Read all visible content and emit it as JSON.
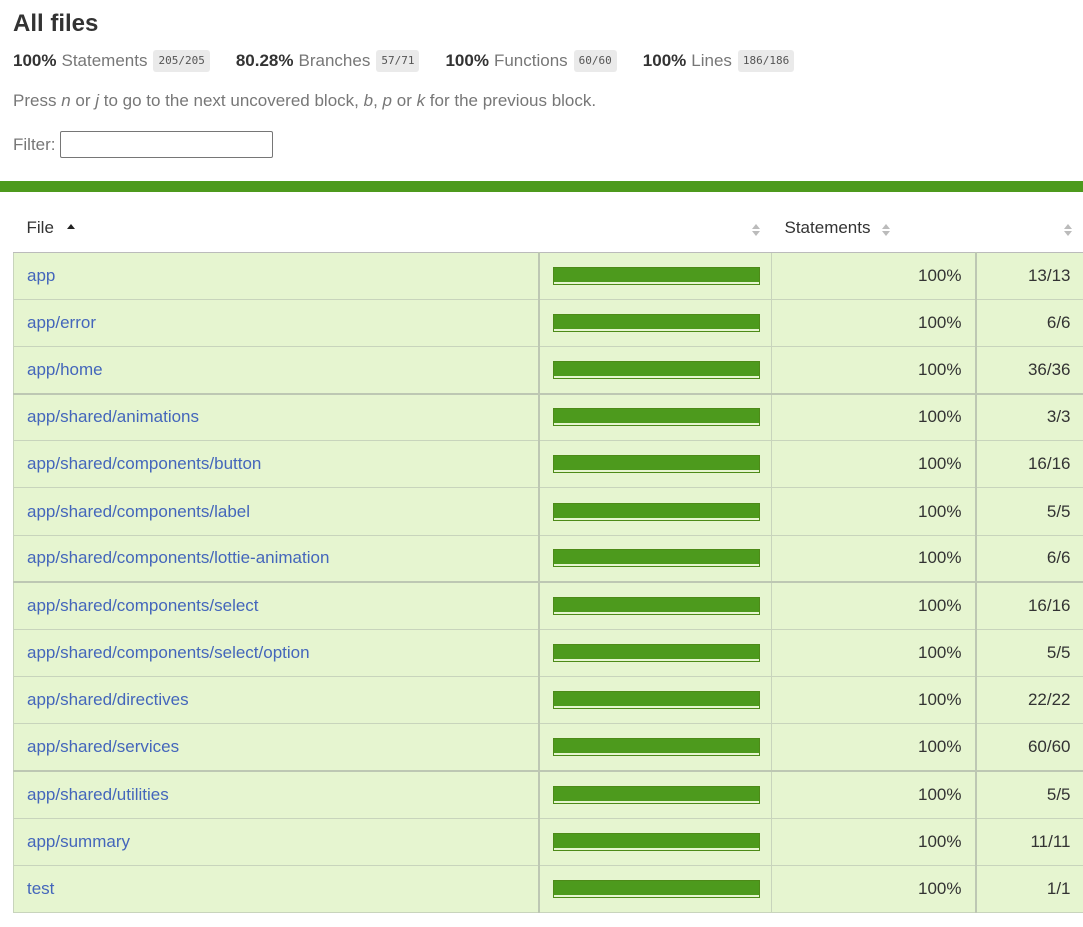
{
  "title": "All files",
  "summary": [
    {
      "pct": "100%",
      "name": "Statements",
      "frac": "205/205"
    },
    {
      "pct": "80.28%",
      "name": "Branches",
      "frac": "57/71"
    },
    {
      "pct": "100%",
      "name": "Functions",
      "frac": "60/60"
    },
    {
      "pct": "100%",
      "name": "Lines",
      "frac": "186/186"
    }
  ],
  "hint": {
    "p1": "Press ",
    "k1": "n",
    "p2": " or ",
    "k2": "j",
    "p3": " to go to the next uncovered block, ",
    "k3": "b",
    "p4": ", ",
    "k4": "p",
    "p5": " or ",
    "k5": "k",
    "p6": " for the previous block."
  },
  "filter": {
    "label": "Filter:",
    "value": "",
    "placeholder": ""
  },
  "colors": {
    "status_bar": "#4d9a1d",
    "row_bg": "#e6f5d0",
    "link": "#4466bb"
  },
  "table": {
    "headers": {
      "file": "File",
      "statements": "Statements"
    },
    "sort": "file-ascending",
    "rows": [
      {
        "file": "app",
        "coverage": 1.0,
        "pct": "100%",
        "abs": "13/13"
      },
      {
        "file": "app/error",
        "coverage": 1.0,
        "pct": "100%",
        "abs": "6/6"
      },
      {
        "file": "app/home",
        "coverage": 1.0,
        "pct": "100%",
        "abs": "36/36"
      },
      {
        "file": "app/shared/animations",
        "coverage": 1.0,
        "pct": "100%",
        "abs": "3/3"
      },
      {
        "file": "app/shared/components/button",
        "coverage": 1.0,
        "pct": "100%",
        "abs": "16/16"
      },
      {
        "file": "app/shared/components/label",
        "coverage": 1.0,
        "pct": "100%",
        "abs": "5/5"
      },
      {
        "file": "app/shared/components/lottie-animation",
        "coverage": 1.0,
        "pct": "100%",
        "abs": "6/6"
      },
      {
        "file": "app/shared/components/select",
        "coverage": 1.0,
        "pct": "100%",
        "abs": "16/16"
      },
      {
        "file": "app/shared/components/select/option",
        "coverage": 1.0,
        "pct": "100%",
        "abs": "5/5"
      },
      {
        "file": "app/shared/directives",
        "coverage": 1.0,
        "pct": "100%",
        "abs": "22/22"
      },
      {
        "file": "app/shared/services",
        "coverage": 1.0,
        "pct": "100%",
        "abs": "60/60"
      },
      {
        "file": "app/shared/utilities",
        "coverage": 1.0,
        "pct": "100%",
        "abs": "5/5"
      },
      {
        "file": "app/summary",
        "coverage": 1.0,
        "pct": "100%",
        "abs": "11/11"
      },
      {
        "file": "test",
        "coverage": 1.0,
        "pct": "100%",
        "abs": "1/1"
      }
    ]
  }
}
